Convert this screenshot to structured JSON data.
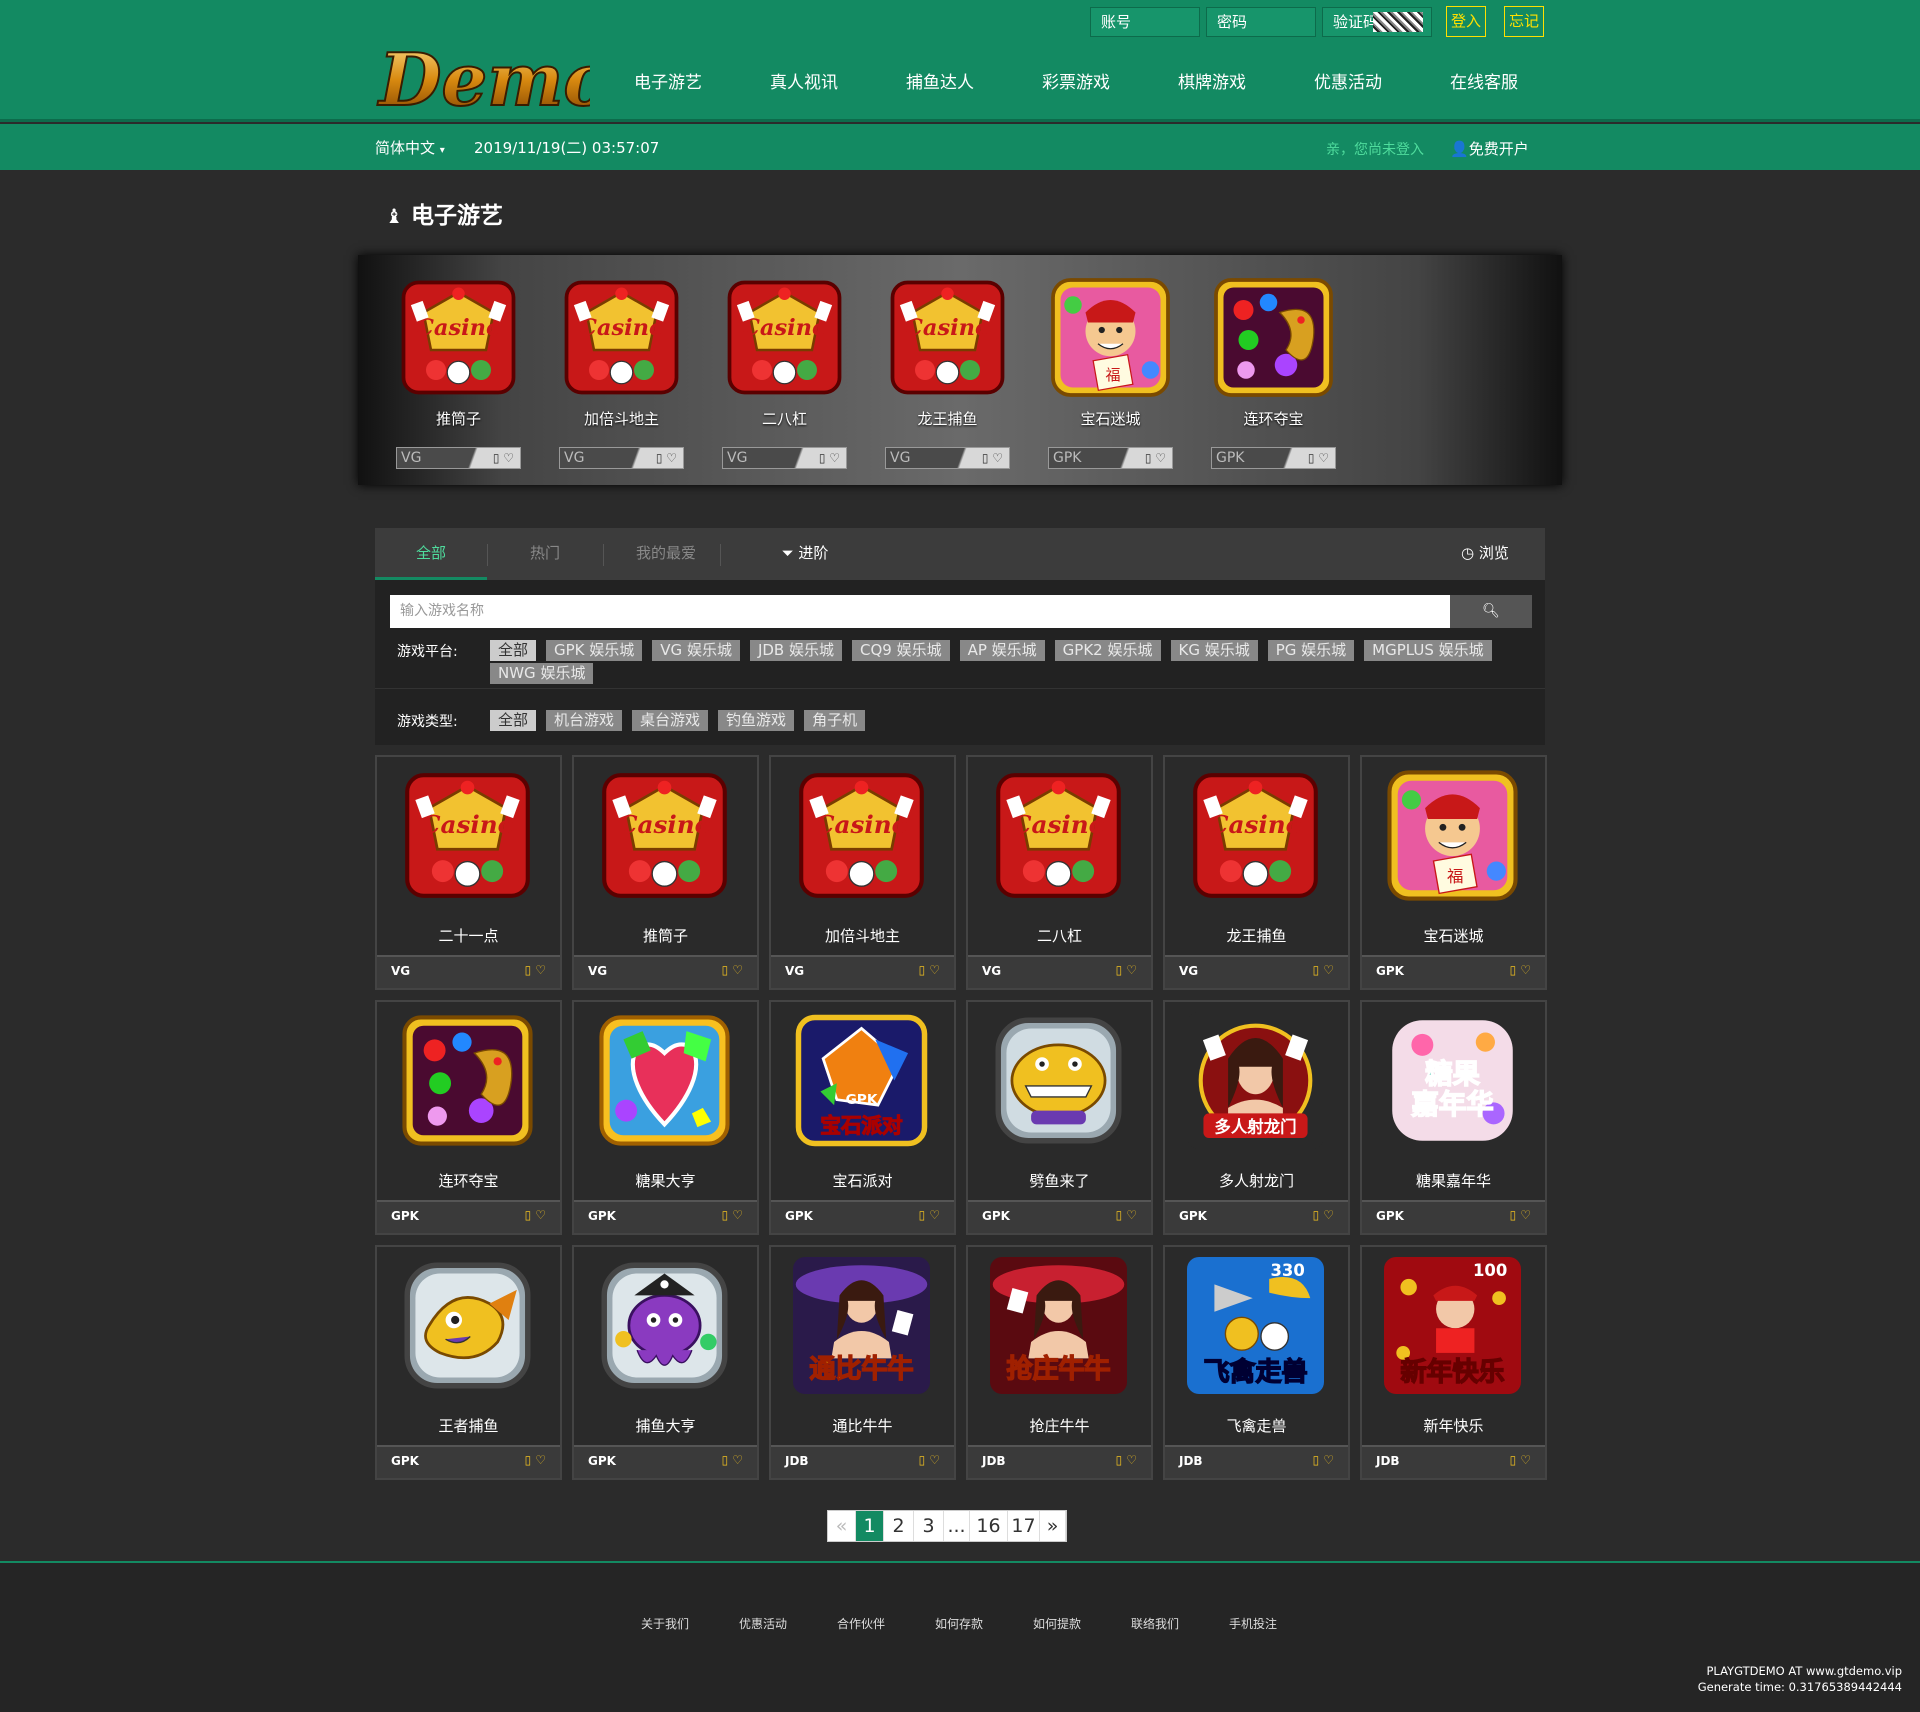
{
  "header": {
    "logo_text": "Demo",
    "account_placeholder": "账号",
    "password_placeholder": "密码",
    "captcha_placeholder": "验证码",
    "login_label": "登入",
    "forgot_label": "忘记",
    "nav": [
      "电子游艺",
      "真人视讯",
      "捕鱼达人",
      "彩票游戏",
      "棋牌游戏",
      "优惠活动",
      "在线客服"
    ]
  },
  "subbar": {
    "language": "简体中文",
    "datetime": "2019/11/19(二) 03:57:07",
    "not_logged": "亲，您尚未登入",
    "register": "免费开户"
  },
  "page_title": "电子游艺",
  "featured": [
    {
      "name": "推筒子",
      "platform": "VG",
      "icon": "casino"
    },
    {
      "name": "加倍斗地主",
      "platform": "VG",
      "icon": "casino"
    },
    {
      "name": "二八杠",
      "platform": "VG",
      "icon": "casino"
    },
    {
      "name": "龙王捕鱼",
      "platform": "VG",
      "icon": "casino"
    },
    {
      "name": "宝石迷城",
      "platform": "GPK",
      "icon": "gem-god"
    },
    {
      "name": "连环夺宝",
      "platform": "GPK",
      "icon": "dragon"
    }
  ],
  "tabs": {
    "all": "全部",
    "hot": "热门",
    "favorites": "我的最爱",
    "advanced": "进阶",
    "browse": "浏览"
  },
  "filter": {
    "search_placeholder": "输入游戏名称",
    "platform_label": "游戏平台:",
    "platforms": [
      "全部",
      "GPK 娱乐城",
      "VG 娱乐城",
      "JDB 娱乐城",
      "CQ9 娱乐城",
      "AP 娱乐城",
      "GPK2 娱乐城",
      "KG 娱乐城",
      "PG 娱乐城",
      "MGPLUS 娱乐城",
      "NWG 娱乐城"
    ],
    "type_label": "游戏类型:",
    "types": [
      "全部",
      "机台游戏",
      "桌台游戏",
      "钓鱼游戏",
      "角子机"
    ]
  },
  "games": [
    {
      "name": "二十一点",
      "platform": "VG",
      "icon": "casino"
    },
    {
      "name": "推筒子",
      "platform": "VG",
      "icon": "casino"
    },
    {
      "name": "加倍斗地主",
      "platform": "VG",
      "icon": "casino"
    },
    {
      "name": "二八杠",
      "platform": "VG",
      "icon": "casino"
    },
    {
      "name": "龙王捕鱼",
      "platform": "VG",
      "icon": "casino"
    },
    {
      "name": "宝石迷城",
      "platform": "GPK",
      "icon": "gem-god"
    },
    {
      "name": "连环夺宝",
      "platform": "GPK",
      "icon": "dragon"
    },
    {
      "name": "糖果大亨",
      "platform": "GPK",
      "icon": "candy"
    },
    {
      "name": "宝石派对",
      "platform": "GPK",
      "icon": "gem-party",
      "icon_text": "宝石派对"
    },
    {
      "name": "劈鱼来了",
      "platform": "GPK",
      "icon": "shark"
    },
    {
      "name": "多人射龙门",
      "platform": "GPK",
      "icon": "lady",
      "icon_text": "多人射龙门"
    },
    {
      "name": "糖果嘉年华",
      "platform": "GPK",
      "icon": "candy-carnival",
      "icon_text": "糖果嘉年华"
    },
    {
      "name": "王者捕鱼",
      "platform": "GPK",
      "icon": "fish"
    },
    {
      "name": "捕鱼大亨",
      "platform": "GPK",
      "icon": "octopus"
    },
    {
      "name": "通比牛牛",
      "platform": "JDB",
      "icon": "niuniu",
      "icon_text": "通比牛牛"
    },
    {
      "name": "抢庄牛牛",
      "platform": "JDB",
      "icon": "niuniu2",
      "icon_text": "抢庄牛牛"
    },
    {
      "name": "飞禽走兽",
      "platform": "JDB",
      "icon": "animals",
      "icon_text": "飞禽走兽",
      "badge": "330"
    },
    {
      "name": "新年快乐",
      "platform": "JDB",
      "icon": "newyear",
      "icon_text": "新年快乐",
      "badge": "100"
    }
  ],
  "pagination": [
    "«",
    "1",
    "2",
    "3",
    "...",
    "16",
    "17",
    "»"
  ],
  "footer": {
    "links": [
      "关于我们",
      "优惠活动",
      "合作伙伴",
      "如何存款",
      "如何提款",
      "联络我们",
      "手机投注"
    ],
    "credit1": "PLAYGTDEMO AT www.gtdemo.vip",
    "credit2": "Generate time: 0.31765389442444"
  },
  "colors": {
    "brand_green": "#138a62",
    "accent_yellow": "#ffe000",
    "bg": "#2b2b2b"
  }
}
